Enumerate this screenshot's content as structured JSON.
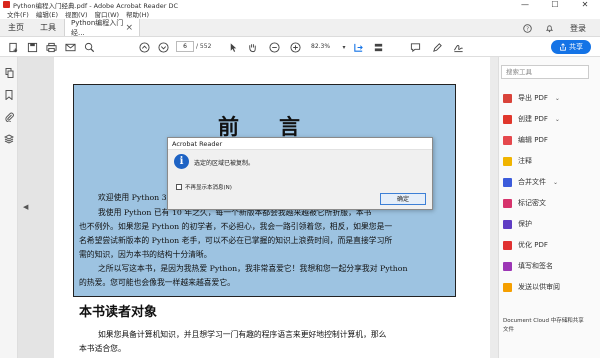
{
  "window": {
    "title": "Python编程入门经典.pdf - Adobe Acrobat Reader DC",
    "minimize": "—",
    "maximize": "☐",
    "close": "✕"
  },
  "menu": [
    "文件(F)",
    "编辑(E)",
    "视图(V)",
    "窗口(W)",
    "帮助(H)"
  ],
  "tabs": {
    "home": "主页",
    "tools": "工具",
    "doc": "Python编程入门经...",
    "doc_close": "×",
    "login": "登录"
  },
  "toolbar": {
    "page_current": "6",
    "page_total": "/ 552",
    "zoom": "82.3%",
    "share_label": "共享"
  },
  "document": {
    "heading": "前言",
    "lines": [
      "欢迎使用 Python 3",
      "我使用 Python 已有 10 年之久，每一个新版本都会我越来越被它所折服，本书",
      "也不例外。如果您是 Python 的初学者，不必担心，我会一路引领着您，相反，如果您是一",
      "名希望尝试新版本的 Python 老手，可以不必在已掌握的知识上浪费时间，而是直接学习所",
      "需的知识，因为本书的结构十分清晰。",
      "之所以写这本书，是因为我热爱 Python，我非常喜爱它！我想和您一起分享我对 Python",
      "的热爱。您可能也会像我一样越来越喜爱它。"
    ],
    "section_title": "本书读者对象",
    "section_lines": [
      "如果您具备计算机知识，并且想学习一门有趣的程序语言来更好地控制计算机，那么",
      "本书适合您。"
    ]
  },
  "dialog": {
    "title": "Acrobat Reader",
    "message": "选定的区域已被复制。",
    "checkbox_label": "不再显示本消息(N)",
    "ok": "确定"
  },
  "right_panel": {
    "search_placeholder": "搜索工具",
    "tools": [
      {
        "label": "导出 PDF",
        "color": "#d9433a",
        "chevron": true
      },
      {
        "label": "创建 PDF",
        "color": "#e0372c",
        "chevron": true
      },
      {
        "label": "编辑 PDF",
        "color": "#e5484d",
        "chevron": false
      },
      {
        "label": "注释",
        "color": "#f0b400",
        "chevron": false
      },
      {
        "label": "合并文件",
        "color": "#3b5bdb",
        "chevron": true
      },
      {
        "label": "标记密文",
        "color": "#d6336c",
        "chevron": false
      },
      {
        "label": "保护",
        "color": "#5f3dc4",
        "chevron": false
      },
      {
        "label": "优化 PDF",
        "color": "#e03131",
        "chevron": false
      },
      {
        "label": "填写和签名",
        "color": "#9c36b5",
        "chevron": false
      },
      {
        "label": "发送以供审阅",
        "color": "#f59f00",
        "chevron": false
      }
    ],
    "promo_line1": "Document Cloud 中存储和共享",
    "promo_line2": "文件"
  }
}
